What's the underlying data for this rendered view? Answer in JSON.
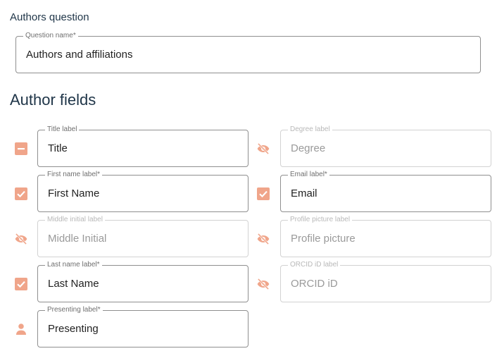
{
  "section": {
    "title": "Authors question",
    "question_name": {
      "label": "Question name*",
      "value": "Authors and affiliations"
    }
  },
  "author_fields": {
    "heading": "Author fields",
    "left": [
      {
        "label": "Title label",
        "value": "Title",
        "state": "indeterminate",
        "icon": "minus-checkbox-icon",
        "enabled": true
      },
      {
        "label": "First name label*",
        "value": "First Name",
        "state": "checked",
        "icon": "checked-checkbox-icon",
        "enabled": true
      },
      {
        "label": "Middle initial label",
        "value": "Middle Initial",
        "state": "hidden",
        "icon": "eye-off-icon",
        "enabled": false
      },
      {
        "label": "Last name label*",
        "value": "Last Name",
        "state": "checked",
        "icon": "checked-checkbox-icon",
        "enabled": true
      },
      {
        "label": "Presenting label*",
        "value": "Presenting",
        "state": "person",
        "icon": "person-icon",
        "enabled": true
      }
    ],
    "right": [
      {
        "label": "Degree label",
        "value": "Degree",
        "state": "hidden",
        "icon": "eye-off-icon",
        "enabled": false
      },
      {
        "label": "Email label*",
        "value": "Email",
        "state": "checked",
        "icon": "checked-checkbox-icon",
        "enabled": true
      },
      {
        "label": "Profile picture label",
        "value": "Profile picture",
        "state": "hidden",
        "icon": "eye-off-icon",
        "enabled": false
      },
      {
        "label": "ORCID iD label",
        "value": "ORCID iD",
        "state": "hidden",
        "icon": "eye-off-icon",
        "enabled": false
      }
    ]
  },
  "colors": {
    "accent": "#f0a58a",
    "title": "#1f3548"
  }
}
